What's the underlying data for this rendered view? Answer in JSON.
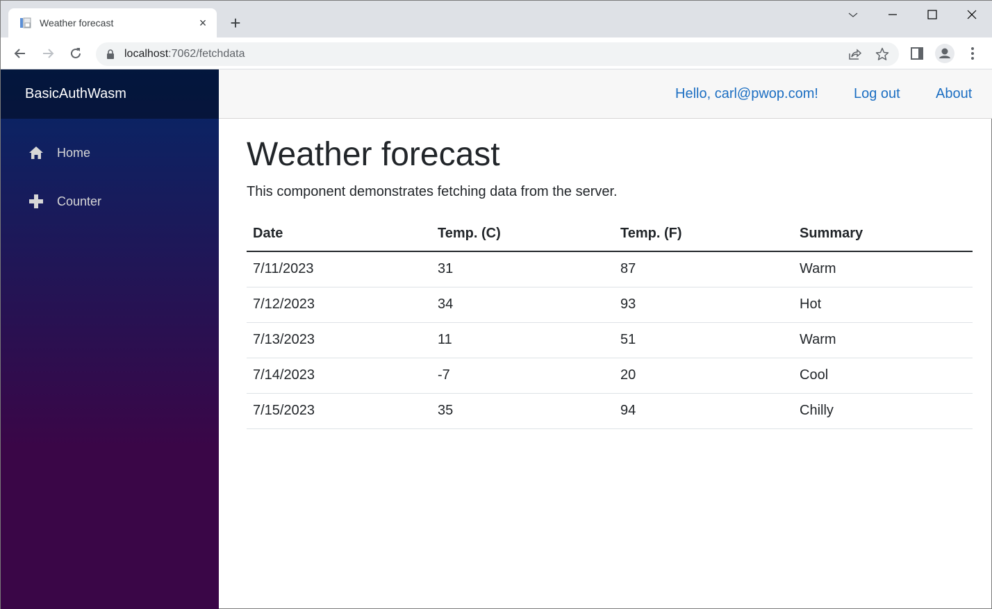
{
  "browser": {
    "tab_title": "Weather forecast",
    "tab_close": "×",
    "new_tab": "+",
    "url_host": "localhost",
    "url_path": ":7062/fetchdata"
  },
  "app": {
    "brand": "BasicAuthWasm",
    "nav": [
      {
        "label": "Home",
        "icon": "home-icon"
      },
      {
        "label": "Counter",
        "icon": "plus-icon"
      }
    ],
    "top_links": {
      "greeting": "Hello, carl@pwop.com!",
      "logout": "Log out",
      "about": "About"
    },
    "colors": {
      "link": "#1b6ec2",
      "sidebar_top": "#052767",
      "sidebar_bottom": "#3a0647"
    }
  },
  "page": {
    "title": "Weather forecast",
    "description": "This component demonstrates fetching data from the server.",
    "table": {
      "headers": [
        "Date",
        "Temp. (C)",
        "Temp. (F)",
        "Summary"
      ],
      "rows": [
        [
          "7/11/2023",
          "31",
          "87",
          "Warm"
        ],
        [
          "7/12/2023",
          "34",
          "93",
          "Hot"
        ],
        [
          "7/13/2023",
          "11",
          "51",
          "Warm"
        ],
        [
          "7/14/2023",
          "-7",
          "20",
          "Cool"
        ],
        [
          "7/15/2023",
          "35",
          "94",
          "Chilly"
        ]
      ]
    }
  }
}
